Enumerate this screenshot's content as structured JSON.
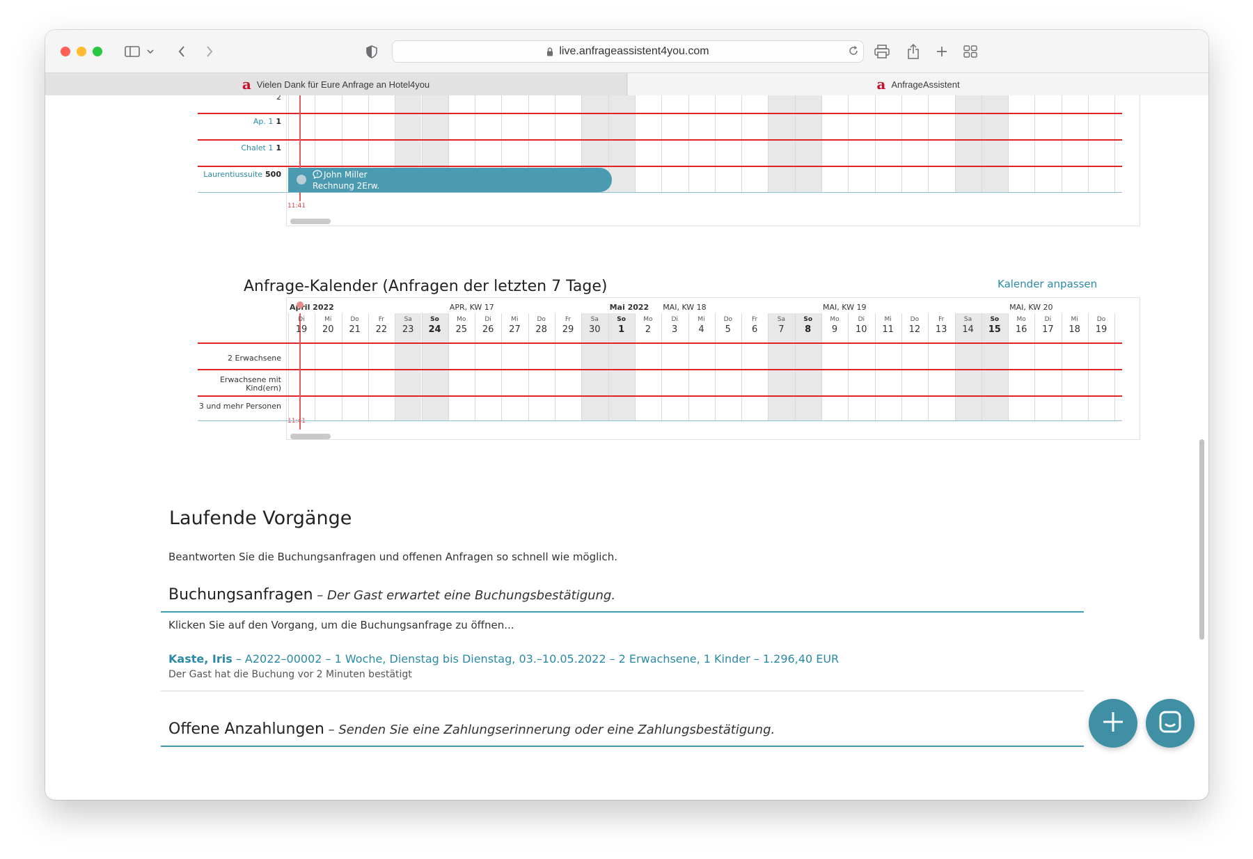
{
  "browser": {
    "url": "live.anfrageassistent4you.com",
    "tabs": [
      {
        "label": "Vielen Dank für Eure Anfrage an Hotel4you",
        "favicon": "a"
      },
      {
        "label": "AnfrageAssistent",
        "favicon": "a"
      }
    ]
  },
  "room_calendar": {
    "partial_label": "2",
    "rows": [
      {
        "label": "Ap. 1",
        "count": "1"
      },
      {
        "label": "Chalet 1",
        "count": "1"
      },
      {
        "label": "Laurentiussuite",
        "count": "500"
      }
    ],
    "booking": {
      "guest": "John Miller",
      "detail": "Rechnung 2Erw.",
      "nights_shown": 12
    },
    "now_label": "11:41"
  },
  "request_calendar": {
    "title": "Anfrage-Kalender (Anfragen der letzten 7 Tage)",
    "adjust_link": "Kalender anpassen",
    "month_labels": [
      {
        "text": "April 2022",
        "bold": true,
        "day_index": 0
      },
      {
        "text": "APR, KW 17",
        "bold": false,
        "day_index": 6
      },
      {
        "text": "Mai 2022",
        "bold": true,
        "day_index": 12
      },
      {
        "text": "MAI, KW 18",
        "bold": false,
        "day_index": 14
      },
      {
        "text": "MAI, KW 19",
        "bold": false,
        "day_index": 20
      },
      {
        "text": "MAI, KW 20",
        "bold": false,
        "day_index": 27
      }
    ],
    "days": [
      {
        "wd": "Di",
        "d": "19"
      },
      {
        "wd": "Mi",
        "d": "20"
      },
      {
        "wd": "Do",
        "d": "21"
      },
      {
        "wd": "Fr",
        "d": "22"
      },
      {
        "wd": "Sa",
        "d": "23"
      },
      {
        "wd": "So",
        "d": "24"
      },
      {
        "wd": "Mo",
        "d": "25"
      },
      {
        "wd": "Di",
        "d": "26"
      },
      {
        "wd": "Mi",
        "d": "27"
      },
      {
        "wd": "Do",
        "d": "28"
      },
      {
        "wd": "Fr",
        "d": "29"
      },
      {
        "wd": "Sa",
        "d": "30"
      },
      {
        "wd": "So",
        "d": "1"
      },
      {
        "wd": "Mo",
        "d": "2"
      },
      {
        "wd": "Di",
        "d": "3"
      },
      {
        "wd": "Mi",
        "d": "4"
      },
      {
        "wd": "Do",
        "d": "5"
      },
      {
        "wd": "Fr",
        "d": "6"
      },
      {
        "wd": "Sa",
        "d": "7"
      },
      {
        "wd": "So",
        "d": "8"
      },
      {
        "wd": "Mo",
        "d": "9"
      },
      {
        "wd": "Di",
        "d": "10"
      },
      {
        "wd": "Mi",
        "d": "11"
      },
      {
        "wd": "Do",
        "d": "12"
      },
      {
        "wd": "Fr",
        "d": "13"
      },
      {
        "wd": "Sa",
        "d": "14"
      },
      {
        "wd": "So",
        "d": "15"
      },
      {
        "wd": "Mo",
        "d": "16"
      },
      {
        "wd": "Di",
        "d": "17"
      },
      {
        "wd": "Mi",
        "d": "18"
      },
      {
        "wd": "Do",
        "d": "19"
      }
    ],
    "rows": [
      {
        "label": "2 Erwachsene"
      },
      {
        "label": "Erwachsene mit Kind(ern)"
      },
      {
        "label": "3 und mehr Personen"
      }
    ],
    "now_label": "11:41"
  },
  "running": {
    "title": "Laufende Vorgänge",
    "intro": "Beantworten Sie die Buchungsanfragen und offenen Anfragen so schnell wie möglich.",
    "booking_requests": {
      "title": "Buchungsanfragen",
      "subtitle": " – Der Gast erwartet eine Buchungsbestätigung.",
      "hint": "Klicken Sie auf den Vorgang, um die Buchungsanfrage zu öffnen...",
      "entry_name": "Kaste, Iris",
      "entry_detail": " – A2022–00002 – 1 Woche, Dienstag bis Dienstag, 03.–10.05.2022 – 2 Erwachsene, 1 Kinder – 1.296,40 EUR",
      "entry_status": "Der Gast hat die Buchung vor 2 Minuten bestätigt"
    },
    "open_deposits": {
      "title": "Offene Anzahlungen",
      "subtitle": " – Senden Sie eine Zahlungserinnerung oder eine Zahlungsbestätigung."
    }
  },
  "colors": {
    "accent": "#2a8aa6",
    "today": "#e02424",
    "booking": "#4a9bb2"
  }
}
